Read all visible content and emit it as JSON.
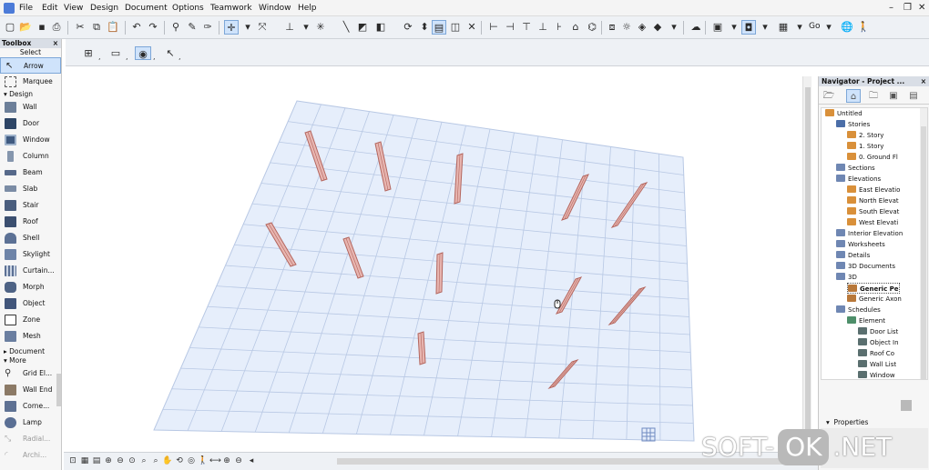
{
  "menubar": {
    "items": [
      "File",
      "Edit",
      "View",
      "Design",
      "Document",
      "Options",
      "Teamwork",
      "Window",
      "Help"
    ],
    "window_controls": [
      "minimize",
      "restore",
      "close"
    ]
  },
  "toolbar": {
    "go_label": "Go"
  },
  "toolbox": {
    "title": "Toolbox",
    "select_label": "Select",
    "select_tools": [
      "Arrow",
      "Marquee"
    ],
    "design_label": "Design",
    "design_tools": [
      "Wall",
      "Door",
      "Window",
      "Column",
      "Beam",
      "Slab",
      "Stair",
      "Roof",
      "Shell",
      "Skylight",
      "Curtain...",
      "Morph",
      "Object",
      "Zone",
      "Mesh"
    ],
    "document_label": "Document",
    "more_label": "More",
    "more_tools": [
      "Grid El...",
      "Wall End",
      "Corne...",
      "Lamp",
      "Radial...",
      "Archi..."
    ]
  },
  "navigator": {
    "title": "Navigator - Project ...",
    "tree": [
      {
        "label": "Untitled",
        "depth": 0,
        "icon": "house-icon"
      },
      {
        "label": "Stories",
        "depth": 1,
        "icon": "stories-icon"
      },
      {
        "label": "2. Story",
        "depth": 2,
        "icon": "story-icon"
      },
      {
        "label": "1. Story",
        "depth": 2,
        "icon": "story-icon"
      },
      {
        "label": "0. Ground Fl",
        "depth": 2,
        "icon": "story-icon"
      },
      {
        "label": "Sections",
        "depth": 1,
        "icon": "section-icon"
      },
      {
        "label": "Elevations",
        "depth": 1,
        "icon": "elevation-icon"
      },
      {
        "label": "East Elevatio",
        "depth": 2,
        "icon": "elevation-item-icon"
      },
      {
        "label": "North Elevat",
        "depth": 2,
        "icon": "elevation-item-icon"
      },
      {
        "label": "South Elevat",
        "depth": 2,
        "icon": "elevation-item-icon"
      },
      {
        "label": "West Elevati",
        "depth": 2,
        "icon": "elevation-item-icon"
      },
      {
        "label": "Interior Elevation",
        "depth": 1,
        "icon": "interior-elevation-icon"
      },
      {
        "label": "Worksheets",
        "depth": 1,
        "icon": "worksheet-icon"
      },
      {
        "label": "Details",
        "depth": 1,
        "icon": "detail-icon"
      },
      {
        "label": "3D Documents",
        "depth": 1,
        "icon": "document-3d-icon"
      },
      {
        "label": "3D",
        "depth": 1,
        "icon": "cube-icon"
      },
      {
        "label": "Generic Pe",
        "depth": 2,
        "icon": "perspective-icon",
        "selected": true
      },
      {
        "label": "Generic Axon",
        "depth": 2,
        "icon": "axonometry-icon"
      },
      {
        "label": "Schedules",
        "depth": 1,
        "icon": "schedule-icon"
      },
      {
        "label": "Element",
        "depth": 2,
        "icon": "element-icon"
      },
      {
        "label": "Door List",
        "depth": 3,
        "icon": "list-icon"
      },
      {
        "label": "Object In",
        "depth": 3,
        "icon": "list-icon"
      },
      {
        "label": "Roof Co",
        "depth": 3,
        "icon": "list-icon"
      },
      {
        "label": "Wall List",
        "depth": 3,
        "icon": "list-icon"
      },
      {
        "label": "Window",
        "depth": 3,
        "icon": "list-icon"
      }
    ],
    "properties_label": "Properties"
  },
  "watermark": {
    "part_a": "SOFT-",
    "part_b": "OK",
    "part_c": ".NET"
  },
  "colors": {
    "grid_fill": "#e6eefb",
    "grid_line": "#b8c8e4",
    "column_fill": "#e7b5b0",
    "column_edge": "#b4665e",
    "selection": "#cfe3fb"
  }
}
